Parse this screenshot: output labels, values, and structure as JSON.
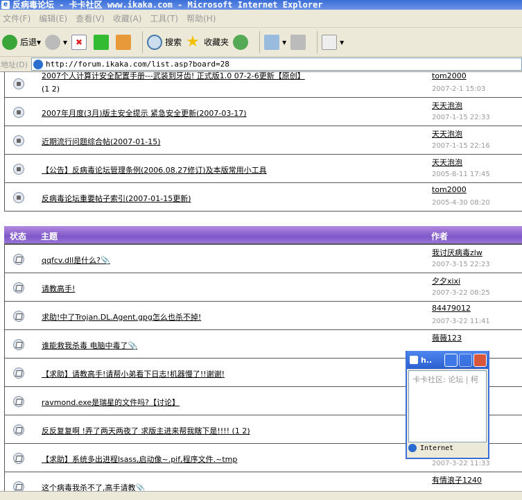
{
  "window": {
    "title": "反病毒论坛 - 卡卡社区 www.ikaka.com - Microsoft Internet Explorer"
  },
  "menu": [
    "文件(F)",
    "编辑(E)",
    "查看(V)",
    "收藏(A)",
    "工具(T)",
    "帮助(H)"
  ],
  "toolbar": {
    "back": "后退",
    "search": "搜索",
    "favorites": "收藏夹"
  },
  "address": {
    "label": "地址(D)",
    "url": "http://forum.ikaka.com/list.asp?board=28"
  },
  "pinned": [
    {
      "title": "2007个人计算计安全配置手册---武装到牙齿! 正式版1.0 07-2-6更新【原创】",
      "pages": "(1 2)",
      "author": "tom2000",
      "date": "2007-2-1 15:03"
    },
    {
      "title": "2007年月度(3月)版主安全提示 紧急安全更新(2007-03-17)",
      "author": "天天泡泡",
      "date": "2007-1-15 22:33"
    },
    {
      "title": "近期流行问题综合帖(2007-01-15)",
      "author": "天天泡泡",
      "date": "2007-1-15 22:16"
    },
    {
      "title": "【公告】反病毒论坛管理条例(2006.08.27修订)及本版常用小工具",
      "author": "天天泡泡",
      "date": "2005-8-11 17:45"
    },
    {
      "title": "反病毒论坛重要帖子索引(2007-01-15更新)",
      "author": "tom2000",
      "date": "2005-4-30 08:20"
    }
  ],
  "header": {
    "status": "状态",
    "topic": "主题",
    "author": "作者"
  },
  "topics": [
    {
      "title": "qqfcv.dll是什么?",
      "clip": "📎",
      "author": "我讨厌病毒zlw",
      "date": "2007-3-15 22:23"
    },
    {
      "title": "请教高手!",
      "author": "夕夕xixi",
      "date": "2007-3-22 08:25"
    },
    {
      "title": "求助!中了Trojan.DL.Agent.gpg怎么也杀不掉!",
      "author": "84479012",
      "date": "2007-3-22 11:41"
    },
    {
      "title": "谁能救我杀毒 电脑中毒了",
      "clip": "📎",
      "author": "薇薇123"
    },
    {
      "title": "【求助】请教高手!请帮小弟看下日志!机器慢了!!谢谢!"
    },
    {
      "title": "ravmond.exe是瑞星的文件吗?【讨论】"
    },
    {
      "title": "反反复复啊 !弄了两天两夜了 求版主进来帮我瞎下是!!!!",
      "pages": "(1 2)"
    },
    {
      "title": "【求助】系统多出进程lsass,启动像~.pif,程序文件.~tmp",
      "date": "2007-3-22 11:33"
    },
    {
      "title": "这个病毒我杀不了,高手请教",
      "clip": "📎",
      "author": "有情浪子1240"
    }
  ],
  "popup": {
    "title": "h..",
    "body": "卡卡社区: 论坛 | 柯",
    "status": "Internet"
  }
}
